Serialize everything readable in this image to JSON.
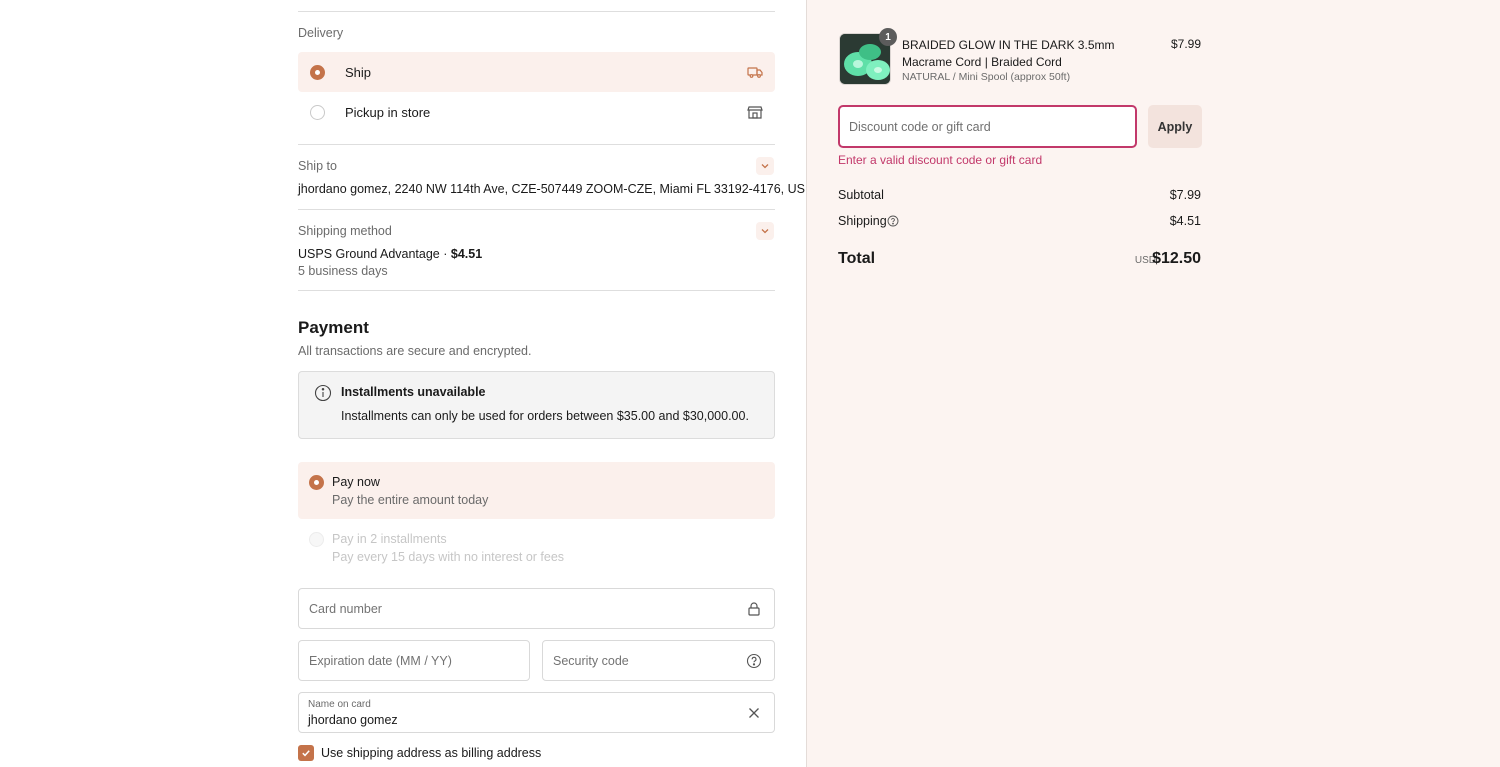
{
  "delivery": {
    "label": "Delivery",
    "options": [
      {
        "label": "Ship",
        "selected": true,
        "icon": "truck-icon"
      },
      {
        "label": "Pickup in store",
        "selected": false,
        "icon": "store-icon"
      }
    ]
  },
  "ship_to": {
    "label": "Ship to",
    "value": "jhordano gomez, 2240 NW 114th Ave, CZE-507449 ZOOM-CZE, Miami FL 33192-4176, US"
  },
  "shipping_method": {
    "label": "Shipping method",
    "name": "USPS Ground Advantage · ",
    "price": "$4.51",
    "eta": "5 business days"
  },
  "payment": {
    "title": "Payment",
    "subtitle": "All transactions are secure and encrypted.",
    "notice_title": "Installments unavailable",
    "notice_text": "Installments can only be used for orders between $35.00 and $30,000.00.",
    "options": [
      {
        "title": "Pay now",
        "desc": "Pay the entire amount today",
        "selected": true,
        "disabled": false
      },
      {
        "title": "Pay in 2 installments",
        "desc": "Pay every 15 days with no interest or fees",
        "selected": false,
        "disabled": true
      }
    ],
    "card_number_placeholder": "Card number",
    "expiry_placeholder": "Expiration date (MM / YY)",
    "security_placeholder": "Security code",
    "name_label": "Name on card",
    "name_value": "jhordano gomez",
    "billing_checkbox_label": "Use shipping address as billing address",
    "billing_checked": true
  },
  "summary": {
    "product": {
      "quantity": "1",
      "name": "BRAIDED GLOW IN THE DARK 3.5mm Macrame Cord | Braided Cord",
      "variant": "NATURAL / Mini Spool (approx 50ft)",
      "price": "$7.99"
    },
    "discount_placeholder": "Discount code or gift card",
    "apply_label": "Apply",
    "discount_error": "Enter a valid discount code or gift card",
    "subtotal_label": "Subtotal",
    "subtotal_value": "$7.99",
    "shipping_label": "Shipping",
    "shipping_value": "$4.51",
    "total_label": "Total",
    "total_currency": "USD",
    "total_value": "$12.50"
  },
  "colors": {
    "accent": "#c4734a",
    "error": "#c2386a",
    "selected_bg": "#fbf0ec",
    "summary_bg": "#fcf4f1"
  }
}
